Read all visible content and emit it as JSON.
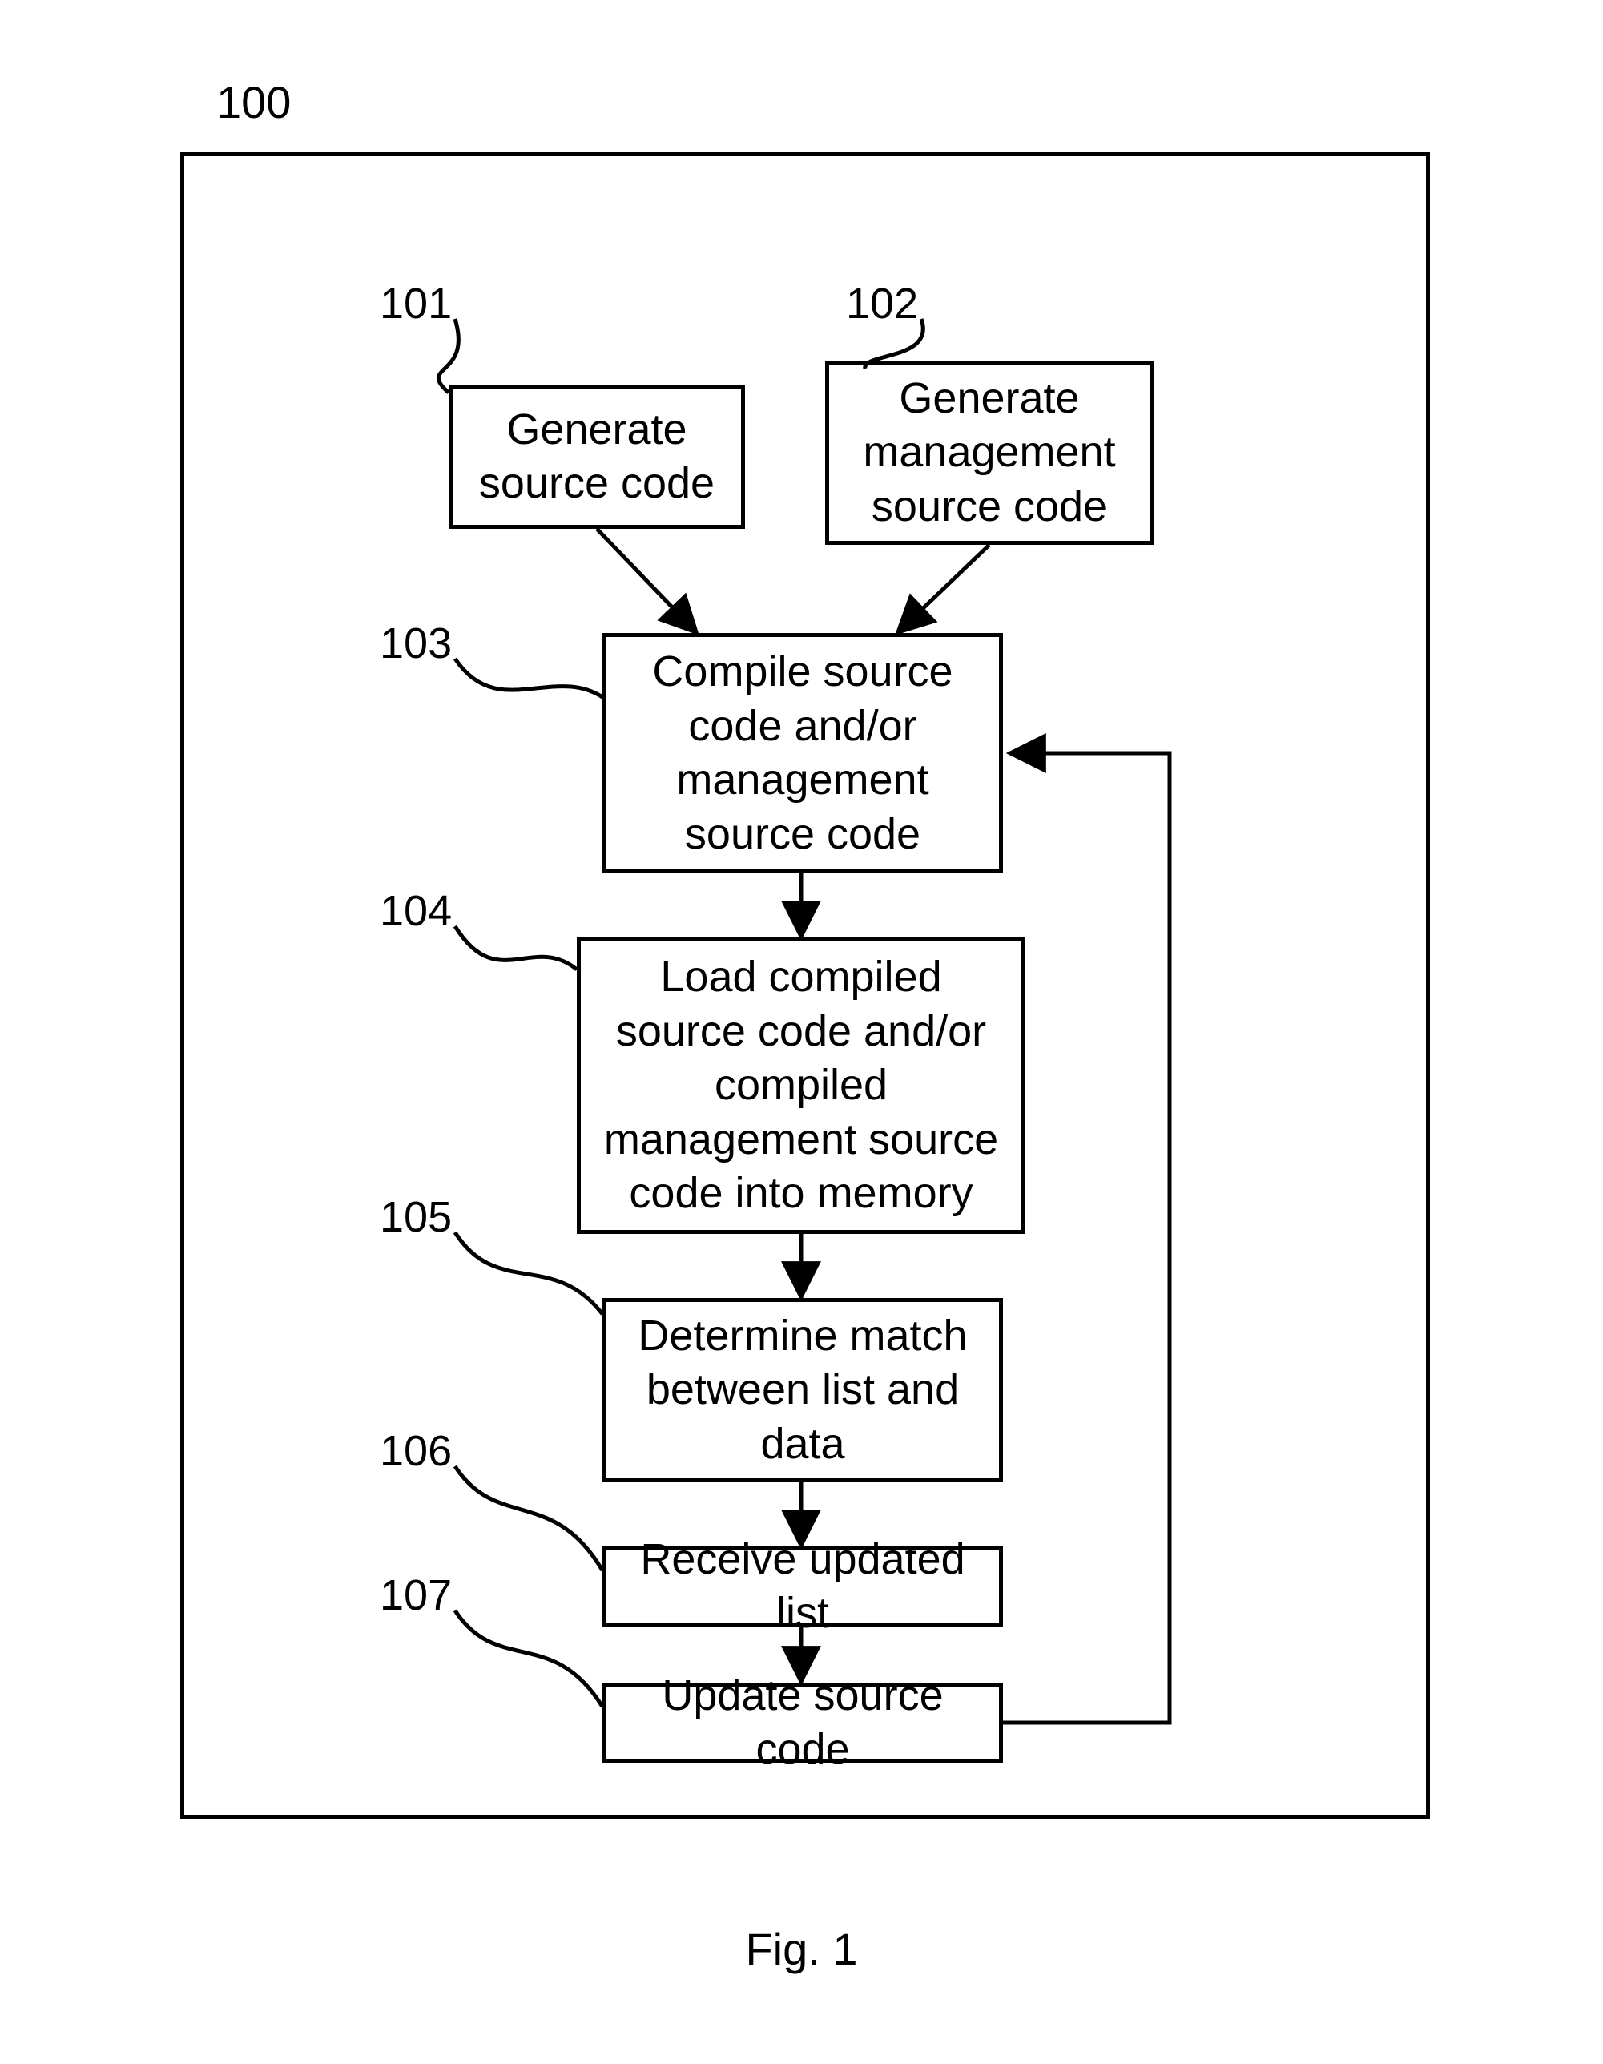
{
  "figure_number_label": "100",
  "caption": "Fig. 1",
  "steps": {
    "s101": {
      "ref": "101",
      "text": "Generate source code"
    },
    "s102": {
      "ref": "102",
      "text": "Generate management source code"
    },
    "s103": {
      "ref": "103",
      "text": "Compile source code and/or management source code"
    },
    "s104": {
      "ref": "104",
      "text": "Load compiled source code and/or compiled management source code into memory"
    },
    "s105": {
      "ref": "105",
      "text": "Determine match between list and data"
    },
    "s106": {
      "ref": "106",
      "text": "Receive updated list"
    },
    "s107": {
      "ref": "107",
      "text": "Update source code"
    }
  },
  "flow_edges": [
    {
      "from": "s101",
      "to": "s103"
    },
    {
      "from": "s102",
      "to": "s103"
    },
    {
      "from": "s103",
      "to": "s104"
    },
    {
      "from": "s104",
      "to": "s105"
    },
    {
      "from": "s105",
      "to": "s106"
    },
    {
      "from": "s106",
      "to": "s107"
    },
    {
      "from": "s107",
      "to": "s103"
    }
  ],
  "chart_data": {
    "type": "flowchart",
    "nodes": [
      {
        "id": "101",
        "label": "Generate source code"
      },
      {
        "id": "102",
        "label": "Generate management source code"
      },
      {
        "id": "103",
        "label": "Compile source code and/or management source code"
      },
      {
        "id": "104",
        "label": "Load compiled source code and/or compiled management source code into memory"
      },
      {
        "id": "105",
        "label": "Determine match between list and data"
      },
      {
        "id": "106",
        "label": "Receive updated list"
      },
      {
        "id": "107",
        "label": "Update source code"
      }
    ],
    "edges": [
      [
        "101",
        "103"
      ],
      [
        "102",
        "103"
      ],
      [
        "103",
        "104"
      ],
      [
        "104",
        "105"
      ],
      [
        "105",
        "106"
      ],
      [
        "106",
        "107"
      ],
      [
        "107",
        "103"
      ]
    ],
    "title": "100"
  }
}
